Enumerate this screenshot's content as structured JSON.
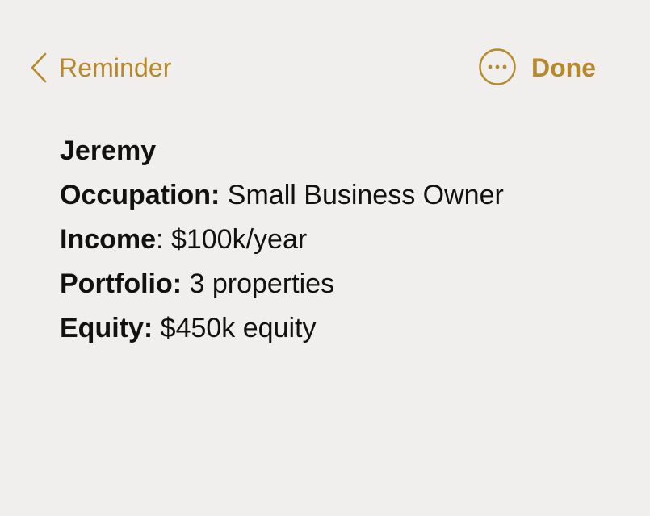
{
  "nav": {
    "back_label": "Reminder",
    "done_label": "Done",
    "back_icon": "chevron-left-icon",
    "more_icon": "ellipsis-circle-icon",
    "accent_color": "#b8892b"
  },
  "note": {
    "title": "Jeremy",
    "fields": [
      {
        "key": "Occupation:",
        "sep": "",
        "value": "Small Business Owner"
      },
      {
        "key": "Income",
        "sep": ":",
        "value": "$100k/year"
      },
      {
        "key": "Portfolio:",
        "sep": "",
        "value": "3 properties"
      },
      {
        "key": "Equity:",
        "sep": "",
        "value": "$450k equity"
      }
    ]
  }
}
